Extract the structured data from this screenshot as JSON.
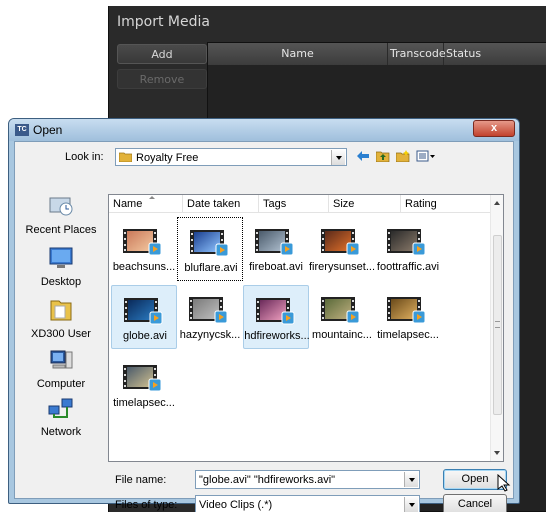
{
  "import_window": {
    "title": "Import Media",
    "add_label": "Add",
    "remove_label": "Remove",
    "columns": [
      "Name",
      "Transcode",
      "Status"
    ]
  },
  "dialog": {
    "icon_text": "TC",
    "title": "Open",
    "close_glyph": "x",
    "look_in_label": "Look in:",
    "look_in_value": "Royalty Free",
    "toolbar_icons": [
      "back-arrow-icon",
      "up-folder-icon",
      "new-folder-icon",
      "views-menu-icon"
    ],
    "places": [
      {
        "label": "Recent Places",
        "icon": "recent-places-icon"
      },
      {
        "label": "Desktop",
        "icon": "desktop-icon"
      },
      {
        "label": "XD300 User",
        "icon": "user-folder-icon"
      },
      {
        "label": "Computer",
        "icon": "computer-icon"
      },
      {
        "label": "Network",
        "icon": "network-icon"
      }
    ],
    "columns": [
      "Name",
      "Date taken",
      "Tags",
      "Size",
      "Rating"
    ],
    "files": [
      {
        "label": "beachsuns...",
        "colors": [
          "#c9795a",
          "#f3c8a0"
        ],
        "selected": false,
        "focused": false
      },
      {
        "label": "bluflare.avi",
        "colors": [
          "#1b3f8f",
          "#8fc4ff"
        ],
        "selected": false,
        "focused": true
      },
      {
        "label": "fireboat.avi",
        "colors": [
          "#4a5a6a",
          "#b0c0d0"
        ],
        "selected": false,
        "focused": false
      },
      {
        "label": "firerysunset...",
        "colors": [
          "#5a2a1a",
          "#e0702a"
        ],
        "selected": false,
        "focused": false
      },
      {
        "label": "foottraffic.avi",
        "colors": [
          "#2a2a2a",
          "#8a7a6a"
        ],
        "selected": false,
        "focused": false
      },
      {
        "label": "globe.avi",
        "colors": [
          "#0a2a5a",
          "#2a7ac0"
        ],
        "selected": true,
        "focused": false
      },
      {
        "label": "hazynycsk...",
        "colors": [
          "#7a7a7a",
          "#c0c0c0"
        ],
        "selected": false,
        "focused": false
      },
      {
        "label": "hdfireworks...",
        "colors": [
          "#6a2a5a",
          "#f0a0c0"
        ],
        "selected": true,
        "focused": false
      },
      {
        "label": "mountainc...",
        "colors": [
          "#5a6a3a",
          "#c0b080"
        ],
        "selected": false,
        "focused": false
      },
      {
        "label": "timelapsec...",
        "colors": [
          "#6a4a1a",
          "#e0b060"
        ],
        "selected": false,
        "focused": false
      },
      {
        "label": "timelapsec...",
        "colors": [
          "#4a5a6a",
          "#d0c090"
        ],
        "selected": false,
        "focused": false
      }
    ],
    "file_name_label": "File name:",
    "file_name_value": "\"globe.avi\" \"hdfireworks.avi\"",
    "file_type_label": "Files of type:",
    "file_type_value": "Video Clips (.*)",
    "open_label": "Open",
    "cancel_label": "Cancel"
  }
}
